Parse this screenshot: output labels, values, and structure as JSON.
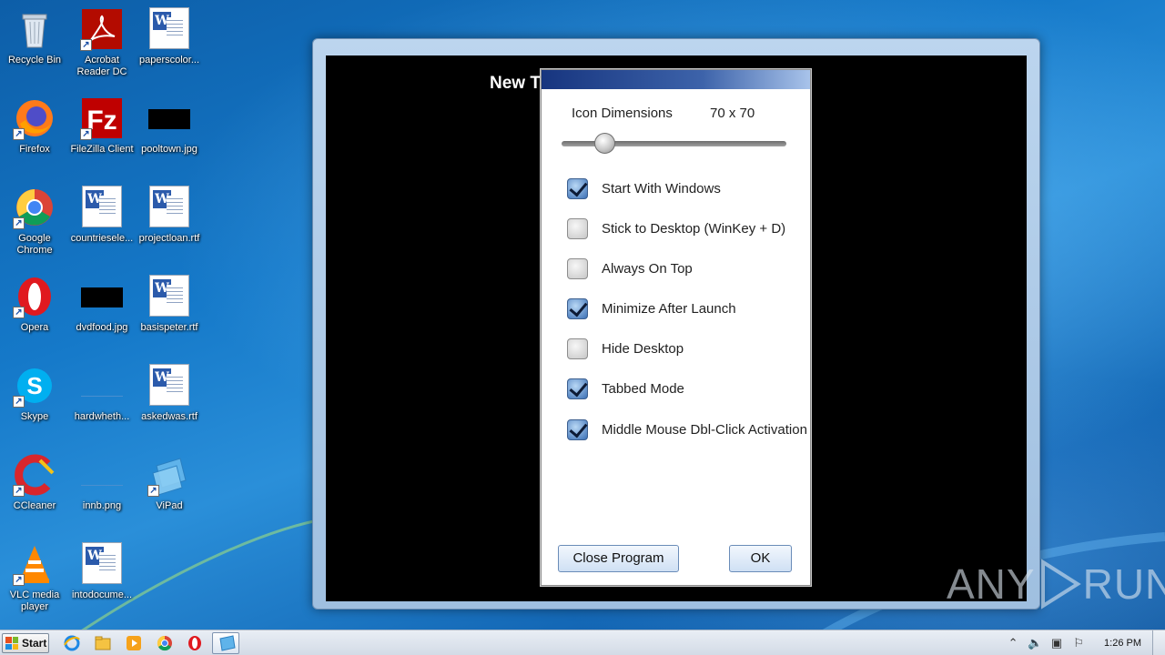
{
  "desktop": {
    "icons": [
      {
        "label": "Recycle Bin"
      },
      {
        "label": "Acrobat Reader DC"
      },
      {
        "label": "paperscolor..."
      },
      {
        "label": "Firefox"
      },
      {
        "label": "FileZilla Client"
      },
      {
        "label": "pooltown.jpg"
      },
      {
        "label": "Google Chrome"
      },
      {
        "label": "countriesele..."
      },
      {
        "label": "projectloan.rtf"
      },
      {
        "label": "Opera"
      },
      {
        "label": "dvdfood.jpg"
      },
      {
        "label": "basispeter.rtf"
      },
      {
        "label": "Skype"
      },
      {
        "label": "hardwheth..."
      },
      {
        "label": "askedwas.rtf"
      },
      {
        "label": "CCleaner"
      },
      {
        "label": "innb.png"
      },
      {
        "label": "ViPad"
      },
      {
        "label": "VLC media player"
      },
      {
        "label": "intodocume..."
      }
    ]
  },
  "app_window": {
    "title_partial": "New T"
  },
  "dialog": {
    "icon_dimensions_label": "Icon Dimensions",
    "icon_dimensions_value": "70 x 70",
    "slider_level": 0.16,
    "options": [
      {
        "label": "Start With Windows",
        "checked": true
      },
      {
        "label": "Stick to Desktop (WinKey + D)",
        "checked": false
      },
      {
        "label": "Always On Top",
        "checked": false
      },
      {
        "label": "Minimize After Launch",
        "checked": true
      },
      {
        "label": "Hide Desktop",
        "checked": false
      },
      {
        "label": "Tabbed Mode",
        "checked": true
      },
      {
        "label": "Middle Mouse Dbl-Click Activation",
        "checked": true
      }
    ],
    "close_button": "Close Program",
    "ok_button": "OK"
  },
  "watermark": {
    "left": "ANY",
    "right": "RUN"
  },
  "taskbar": {
    "start_label": "Start",
    "clock": "1:26 PM"
  },
  "colors": {
    "dialog_title_start": "#17357f",
    "checkbox_on": "#3a6fb5"
  }
}
